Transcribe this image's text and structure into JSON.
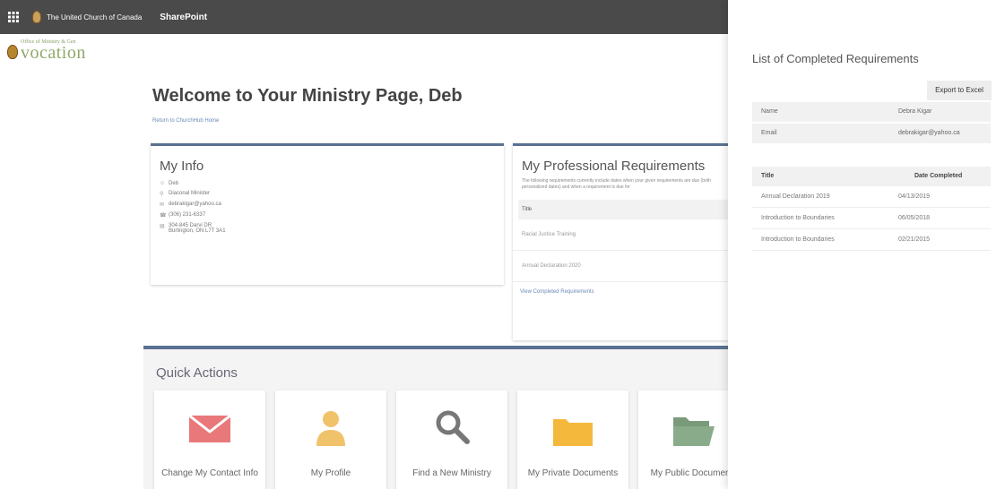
{
  "suite_bar": {
    "org_name": "The United Church of Canada",
    "app_name": "SharePoint",
    "waffle_icon": "app-launcher-icon"
  },
  "logo": {
    "small_text": "Office of Ministry & Gen",
    "big_text": "vocation"
  },
  "main": {
    "welcome": "Welcome to Your Ministry Page, Deb",
    "return_link": "Return to ChurchHub Home",
    "my_info": {
      "title": "My Info",
      "name": "Deb",
      "role": "Diaconal Minister",
      "email": "debrakigar@yahoo.ca",
      "phone": "(306) 231-6337",
      "address_line1": "304-845 Darvi DR",
      "address_line2": "Burlington, ON L7T 3A1"
    },
    "professional": {
      "title": "My Professional Requirements",
      "description": "The following requirements currently include dates when your given requirements are due (both personalized dates) and when a requirement is due for",
      "column_title": "Title",
      "rows": [
        "Racial Justice Training",
        "Annual Declaration 2020"
      ],
      "view_link": "View Completed Requirements"
    },
    "quick_actions": {
      "title": "Quick Actions",
      "tiles": [
        {
          "label": "Change My Contact Info",
          "icon": "envelope-icon"
        },
        {
          "label": "My Profile",
          "icon": "person-icon"
        },
        {
          "label": "Find a New Ministry",
          "icon": "search-icon"
        },
        {
          "label": "My Private Documents",
          "icon": "folder-icon"
        },
        {
          "label": "My Public Documents",
          "icon": "open-folder-icon"
        }
      ]
    }
  },
  "panel": {
    "title": "List of Completed Requirements",
    "export_label": "Export to Excel",
    "name_label": "Name",
    "name_value": "Debra Kigar",
    "email_label": "Email",
    "email_value": "debrakigar@yahoo.ca",
    "col_title": "Title",
    "col_date": "Date Completed",
    "rows": [
      {
        "title": "Annual Declaration 2019",
        "date": "04/13/2019"
      },
      {
        "title": "Introduction to Boundaries",
        "date": "06/05/2018"
      },
      {
        "title": "Introduction to Boundaries",
        "date": "02/21/2015"
      }
    ]
  },
  "colors": {
    "suite_bar": "#4a4a4a",
    "accent": "#5a7192",
    "envelope": "#e8787a",
    "person": "#f0c26a",
    "folder": "#f4b93c",
    "open_folder": "#8aab8a"
  }
}
